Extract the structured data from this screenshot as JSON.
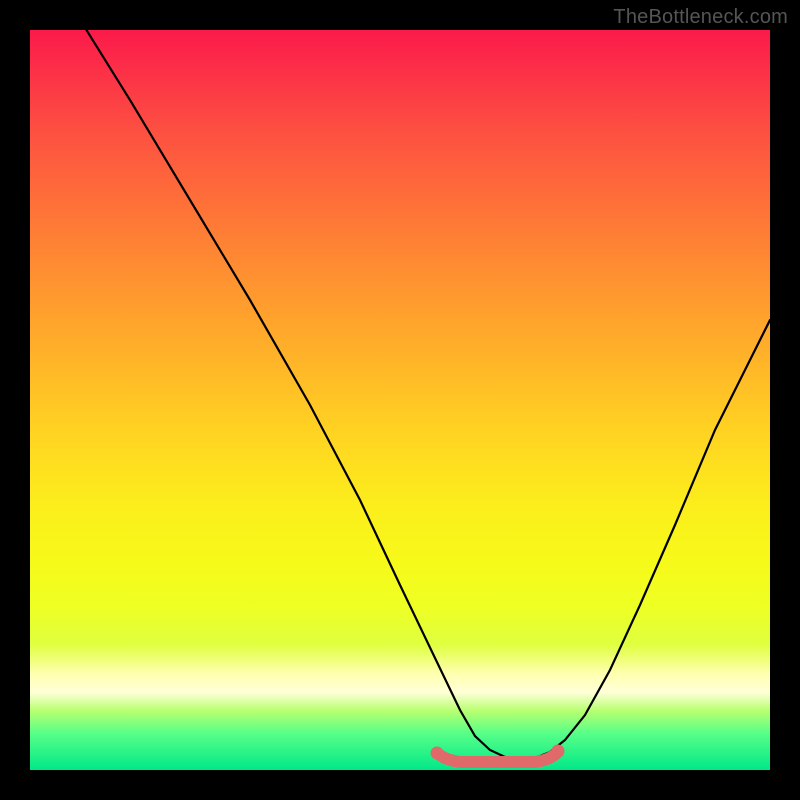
{
  "watermark": "TheBottleneck.com",
  "chart_data": {
    "type": "line",
    "title": "",
    "xlabel": "",
    "ylabel": "",
    "xlim": [
      0,
      100
    ],
    "ylim": [
      0,
      100
    ],
    "curve": {
      "description": "V-shaped bottleneck curve, descending from top-left to a flat minimum zone then rising to the right edge",
      "x": [
        0,
        6,
        12,
        18,
        24,
        30,
        36,
        42,
        48,
        51,
        54,
        58,
        62,
        66,
        70,
        74,
        78,
        82,
        86,
        90,
        94,
        100
      ],
      "y": [
        108,
        96,
        84,
        72,
        60,
        48,
        36,
        24,
        12,
        6,
        3,
        1.5,
        1,
        1,
        1.5,
        3,
        8,
        16,
        26,
        36,
        46,
        60
      ]
    },
    "sweet_spot": {
      "x_range": [
        51,
        70
      ],
      "y": 2,
      "color": "#e56a6a"
    },
    "colors": {
      "gradient_top": "#fb1a4a",
      "gradient_bottom": "#00e888",
      "background": "#000000",
      "curve": "#000000"
    }
  }
}
